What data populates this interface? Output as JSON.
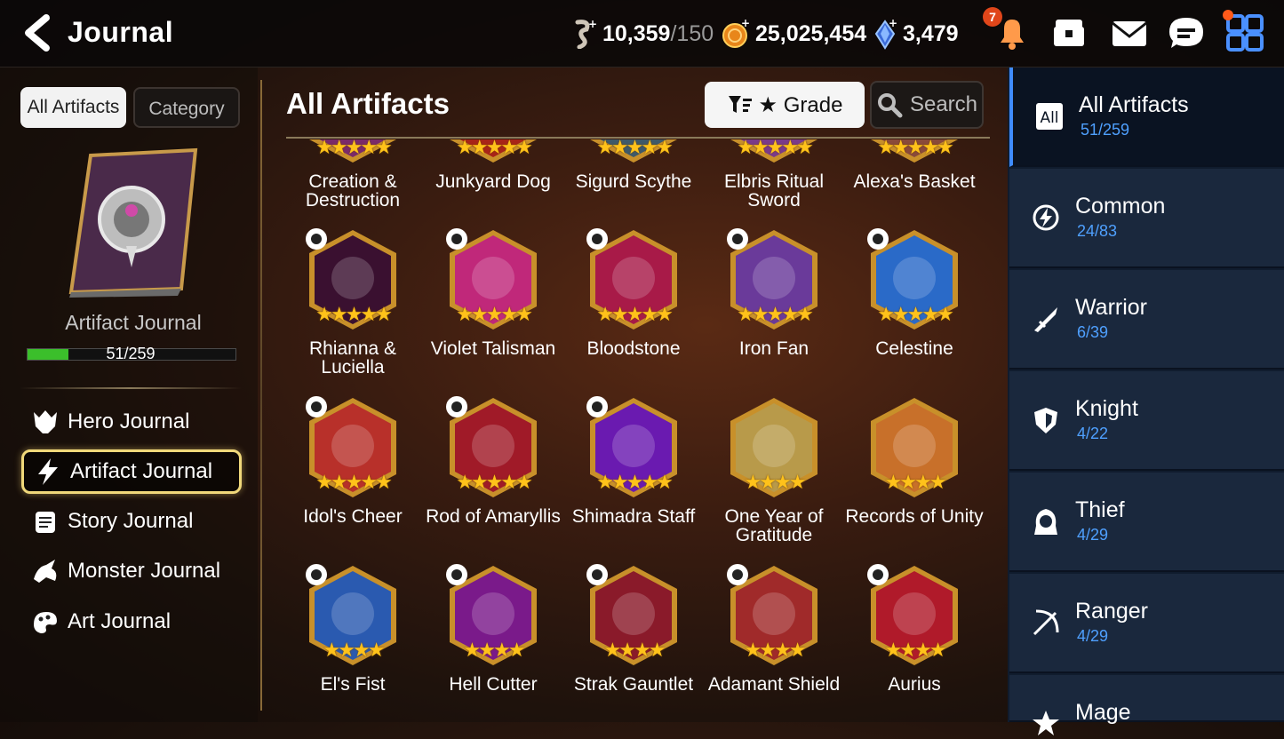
{
  "header": {
    "title": "Journal",
    "stamina": "10,359",
    "stamina_max": "/150",
    "gold": "25,025,454",
    "gems": "3,479",
    "notif_count": "7"
  },
  "left": {
    "tab_all": "All Artifacts",
    "tab_category": "Category",
    "journal_label": "Artifact Journal",
    "progress_text": "51/259",
    "progress_fraction": 0.197,
    "nav": [
      {
        "label": "Hero Journal",
        "icon": "hero-icon"
      },
      {
        "label": "Artifact Journal",
        "icon": "lightning-icon"
      },
      {
        "label": "Story Journal",
        "icon": "scroll-icon"
      },
      {
        "label": "Monster Journal",
        "icon": "monster-icon"
      },
      {
        "label": "Art Journal",
        "icon": "palette-icon"
      }
    ]
  },
  "main": {
    "title": "All Artifacts",
    "grade_label": "★ Grade",
    "search_label": "Search",
    "artifacts": [
      {
        "name": "Creation & Destruction",
        "stars": "★★★★★",
        "color": "#7a2a6a",
        "class": ""
      },
      {
        "name": "Junkyard Dog",
        "stars": "★★★★★",
        "color": "#a82418",
        "class": ""
      },
      {
        "name": "Sigurd Scythe",
        "stars": "★★★★★",
        "color": "#3e5a6a",
        "class": ""
      },
      {
        "name": "Elbris Ritual Sword",
        "stars": "★★★★★",
        "color": "#7a3a8a",
        "class": ""
      },
      {
        "name": "Alexa's Basket",
        "stars": "★★★★★",
        "color": "#8a4a3a",
        "class": ""
      },
      {
        "name": "Rhianna & Luciella",
        "stars": "★★★★★",
        "color": "#3a1030",
        "class": "thief"
      },
      {
        "name": "Violet Talisman",
        "stars": "★★★★★",
        "color": "#c0287a",
        "class": "thief"
      },
      {
        "name": "Bloodstone",
        "stars": "★★★★★",
        "color": "#a81a48",
        "class": "ranger"
      },
      {
        "name": "Iron Fan",
        "stars": "★★★★★",
        "color": "#6a3a9a",
        "class": "ranger"
      },
      {
        "name": "Celestine",
        "stars": "★★★★★",
        "color": "#2a6ac8",
        "class": "common"
      },
      {
        "name": "Idol's Cheer",
        "stars": "★★★★★",
        "color": "#b8302a",
        "class": "common"
      },
      {
        "name": "Rod of Amaryllis",
        "stars": "★★★★★",
        "color": "#a01a28",
        "class": "common"
      },
      {
        "name": "Shimadra Staff",
        "stars": "★★★★★",
        "color": "#6a1ab0",
        "class": "common"
      },
      {
        "name": "One Year of Gratitude",
        "stars": "★★★★",
        "color": "#b89a4a",
        "class": ""
      },
      {
        "name": "Records of Unity",
        "stars": "★★★★",
        "color": "#c8702a",
        "class": ""
      },
      {
        "name": "El's Fist",
        "stars": "★★★★",
        "color": "#2a5ab0",
        "class": "warrior"
      },
      {
        "name": "Hell Cutter",
        "stars": "★★★★",
        "color": "#7a1a8a",
        "class": "warrior"
      },
      {
        "name": "Strak Gauntlet",
        "stars": "★★★★",
        "color": "#8a1a2a",
        "class": "warrior"
      },
      {
        "name": "Adamant Shield",
        "stars": "★★★★",
        "color": "#a02a2a",
        "class": "knight"
      },
      {
        "name": "Aurius",
        "stars": "★★★★",
        "color": "#b01a2a",
        "class": "knight"
      }
    ]
  },
  "categories": [
    {
      "name": "All Artifacts",
      "count": "51/259",
      "icon": "all-icon",
      "icon_text": "All"
    },
    {
      "name": "Common",
      "count": "24/83",
      "icon": "common-icon"
    },
    {
      "name": "Warrior",
      "count": "6/39",
      "icon": "warrior-icon"
    },
    {
      "name": "Knight",
      "count": "4/22",
      "icon": "knight-icon"
    },
    {
      "name": "Thief",
      "count": "4/29",
      "icon": "thief-icon"
    },
    {
      "name": "Ranger",
      "count": "4/29",
      "icon": "ranger-icon"
    },
    {
      "name": "Mage",
      "count": "",
      "icon": "mage-icon"
    }
  ]
}
